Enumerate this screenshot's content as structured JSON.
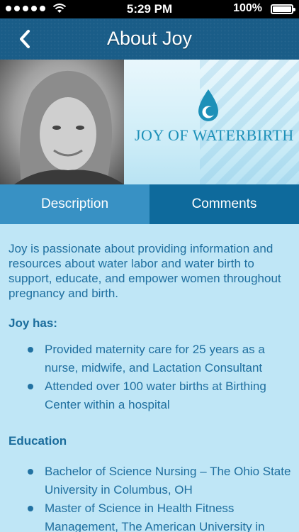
{
  "status_bar": {
    "time": "5:29 PM",
    "battery_percent": "100%"
  },
  "navbar": {
    "title": "About Joy",
    "back_icon": "chevron-left-icon"
  },
  "banner": {
    "logo_text": "JOY OF WATERBIRTH",
    "logo_icon": "water-drop-icon"
  },
  "tabs": [
    {
      "label": "Description",
      "active": true
    },
    {
      "label": "Comments",
      "active": false
    }
  ],
  "content": {
    "intro": "Joy is passionate about providing information and resources about water labor and water birth to support, educate, and empower women throughout pregnancy and birth.",
    "sections": [
      {
        "title": "Joy has:",
        "items": [
          "Provided maternity care for 25 years as a nurse, midwife, and Lactation Consultant",
          "Attended over 100 water births at Birthing Center within a hospital"
        ]
      },
      {
        "title": "Education",
        "items": [
          "Bachelor of Science Nursing – The Ohio State University in Columbus, OH",
          "Master of Science in Health Fitness Management, The American University in"
        ]
      }
    ]
  },
  "colors": {
    "navbar": "#1a5d88",
    "tab_active": "#3891c4",
    "tab_inactive": "#0e6a9c",
    "content_bg": "#bfe6f6",
    "text": "#1f6f9f"
  }
}
